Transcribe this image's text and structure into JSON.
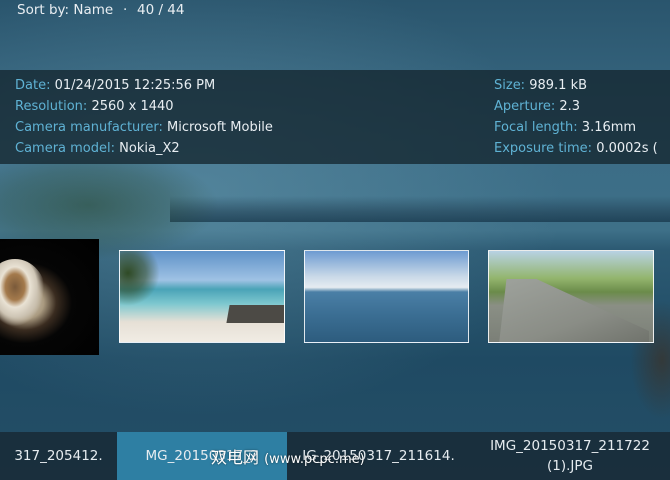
{
  "header": {
    "sort_label": "Sort by: Name",
    "separator": "·",
    "position": "40 / 44"
  },
  "info": {
    "left": [
      {
        "label": "Date:",
        "value": "01/24/2015 12:25:56 PM"
      },
      {
        "label": "Resolution:",
        "value": "2560 x 1440"
      },
      {
        "label": "Camera manufacturer:",
        "value": "Microsoft Mobile"
      },
      {
        "label": "Camera model:",
        "value": "Nokia_X2"
      }
    ],
    "right": [
      {
        "label": "Size:",
        "value": "989.1 kB"
      },
      {
        "label": "Aperture:",
        "value": "2.3"
      },
      {
        "label": "Focal length:",
        "value": "3.16mm"
      },
      {
        "label": "Exposure time:",
        "value": "0.0002s ("
      }
    ]
  },
  "thumbnails": [
    {
      "icon": "coffee-cup-thumbnail"
    },
    {
      "icon": "beach-thumbnail"
    },
    {
      "icon": "sea-horizon-thumbnail"
    },
    {
      "icon": "tree-road-thumbnail"
    }
  ],
  "captions": [
    {
      "text": "317_205412."
    },
    {
      "text": "MG_20150317_2"
    },
    {
      "text": "IG_20150317_211614."
    },
    {
      "line1": "IMG_20150317_211722",
      "line2": "(1).JPG"
    }
  ],
  "watermark": {
    "text": "双电网",
    "url": "(www.pcpc.me)"
  },
  "colors": {
    "label": "#5fb2d4",
    "selected_caption": "#2e7fa3"
  }
}
